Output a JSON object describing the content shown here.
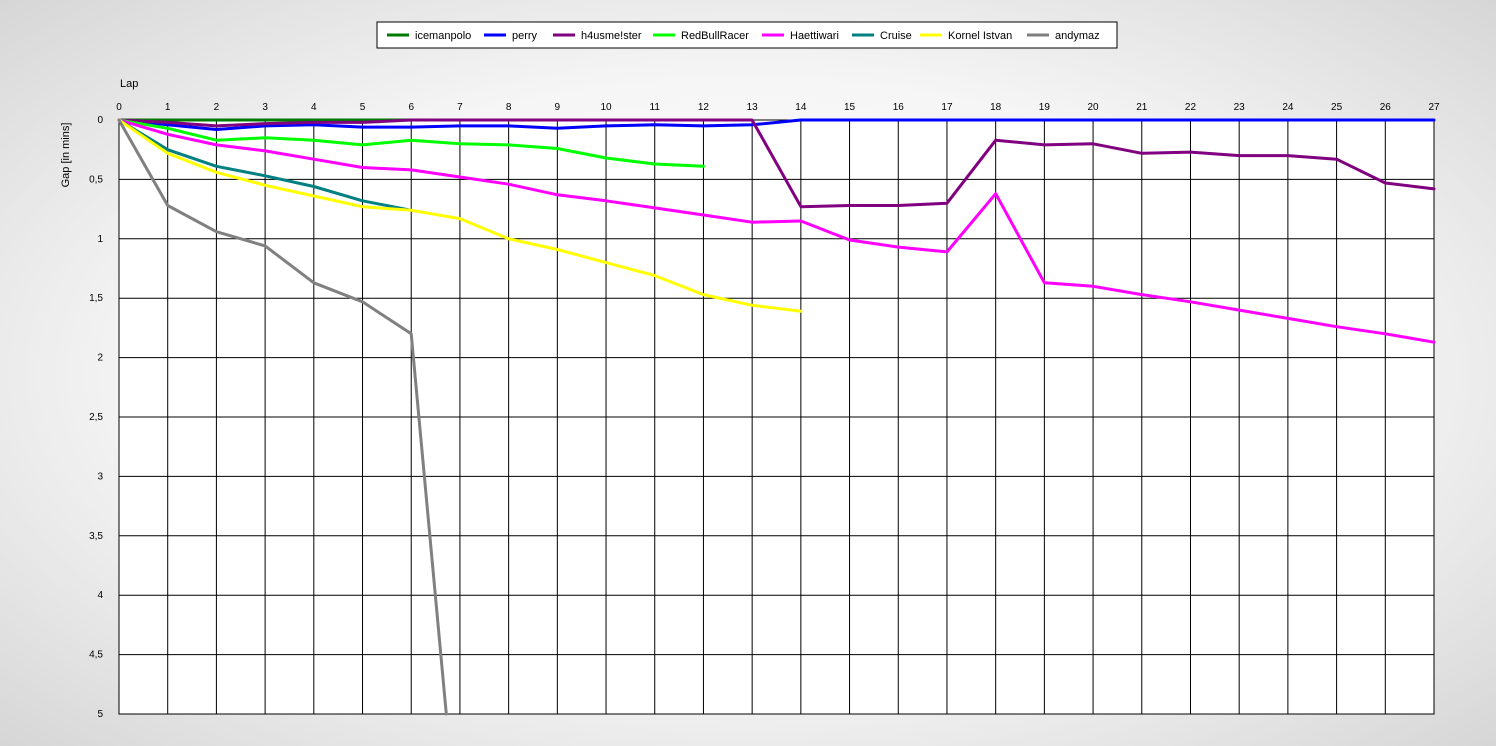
{
  "chart_data": {
    "type": "line",
    "xlabel": "Lap",
    "ylabel": "Gap [in mins]",
    "xlim": [
      0,
      27
    ],
    "ylim": [
      0,
      5
    ],
    "y_inverted": true,
    "x_axis_position": "top",
    "grid": true,
    "legend_position": "top-center",
    "x_ticks": [
      "0",
      "1",
      "2",
      "3",
      "4",
      "5",
      "6",
      "7",
      "8",
      "9",
      "10",
      "11",
      "12",
      "13",
      "14",
      "15",
      "16",
      "17",
      "18",
      "19",
      "20",
      "21",
      "22",
      "23",
      "24",
      "25",
      "26",
      "27"
    ],
    "y_ticks": [
      "0",
      "0,5",
      "1",
      "1,5",
      "2",
      "2,5",
      "3",
      "3,5",
      "4",
      "4,5",
      "5"
    ],
    "series": [
      {
        "name": "icemanpolo",
        "color": "#007b00",
        "x": [
          0,
          1,
          2,
          3,
          4,
          5,
          6
        ],
        "y": [
          0,
          0,
          0,
          0,
          0,
          0,
          0
        ]
      },
      {
        "name": "perry",
        "color": "#0000ff",
        "x": [
          0,
          1,
          2,
          3,
          4,
          5,
          6,
          7,
          8,
          9,
          10,
          11,
          12,
          13,
          14,
          15,
          16,
          17,
          18,
          19,
          20,
          21,
          22,
          23,
          24,
          25,
          26,
          27
        ],
        "y": [
          0,
          0.04,
          0.08,
          0.05,
          0.04,
          0.06,
          0.06,
          0.05,
          0.05,
          0.07,
          0.05,
          0.04,
          0.05,
          0.04,
          0,
          0,
          0,
          0,
          0,
          0,
          0,
          0,
          0,
          0,
          0,
          0,
          0,
          0
        ]
      },
      {
        "name": "h4usme!ster",
        "color": "#800080",
        "x": [
          0,
          1,
          2,
          3,
          4,
          5,
          6,
          7,
          8,
          9,
          10,
          11,
          12,
          13,
          14,
          15,
          16,
          17,
          18,
          19,
          20,
          21,
          22,
          23,
          24,
          25,
          26,
          27
        ],
        "y": [
          0,
          0.02,
          0.05,
          0.03,
          0.02,
          0.02,
          0,
          0,
          0,
          0,
          0,
          0,
          0,
          0,
          0.73,
          0.72,
          0.72,
          0.7,
          0.17,
          0.21,
          0.2,
          0.28,
          0.27,
          0.3,
          0.3,
          0.33,
          0.53,
          0.58
        ]
      },
      {
        "name": "RedBullRacer",
        "color": "#00ff00",
        "x": [
          0,
          1,
          2,
          3,
          4,
          5,
          6,
          7,
          8,
          9,
          10,
          11,
          12
        ],
        "y": [
          0,
          0.07,
          0.17,
          0.15,
          0.17,
          0.21,
          0.17,
          0.2,
          0.21,
          0.24,
          0.32,
          0.37,
          0.39
        ]
      },
      {
        "name": "Haettiwari",
        "color": "#ff00ff",
        "x": [
          0,
          1,
          2,
          3,
          4,
          5,
          6,
          7,
          8,
          9,
          10,
          11,
          12,
          13,
          14,
          15,
          16,
          17,
          18,
          19,
          20,
          21,
          22,
          23,
          24,
          25,
          26,
          27
        ],
        "y": [
          0,
          0.12,
          0.21,
          0.26,
          0.33,
          0.4,
          0.42,
          0.48,
          0.54,
          0.63,
          0.68,
          0.74,
          0.8,
          0.86,
          0.85,
          1.01,
          1.07,
          1.11,
          0.62,
          1.37,
          1.4,
          1.47,
          1.53,
          1.6,
          1.67,
          1.74,
          1.8,
          1.87
        ]
      },
      {
        "name": "Cruise",
        "color": "#008080",
        "x": [
          0,
          1,
          2,
          3,
          4,
          5,
          6
        ],
        "y": [
          0,
          0.25,
          0.39,
          0.47,
          0.56,
          0.68,
          0.76
        ]
      },
      {
        "name": "Kornel Istvan",
        "color": "#ffff00",
        "x": [
          0,
          1,
          2,
          3,
          4,
          5,
          6,
          7,
          8,
          9,
          10,
          11,
          12,
          13,
          14
        ],
        "y": [
          0,
          0.28,
          0.44,
          0.55,
          0.64,
          0.73,
          0.76,
          0.83,
          1.0,
          1.09,
          1.2,
          1.31,
          1.47,
          1.56,
          1.61
        ]
      },
      {
        "name": "andymaz",
        "color": "#808080",
        "x": [
          0,
          1,
          2,
          3,
          4,
          5,
          6,
          6.72
        ],
        "y": [
          0,
          0.72,
          0.94,
          1.06,
          1.37,
          1.53,
          1.8,
          5.0
        ]
      }
    ]
  }
}
